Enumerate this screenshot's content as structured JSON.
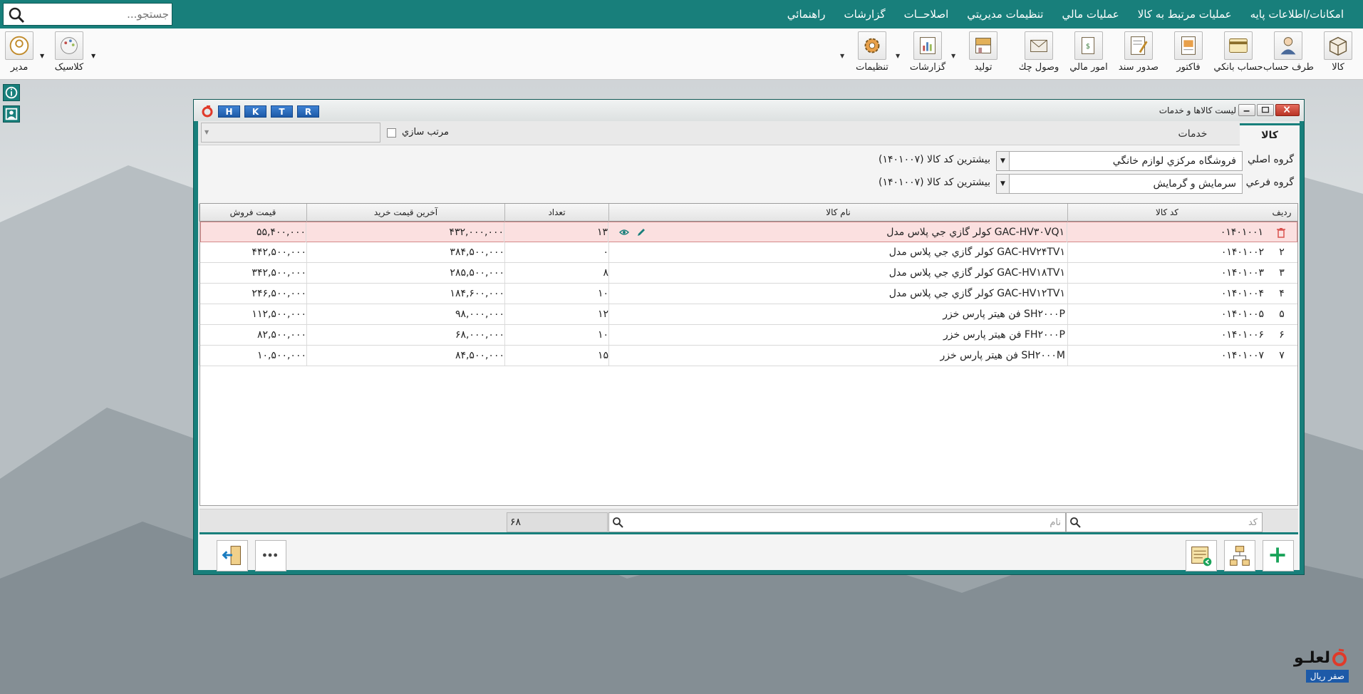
{
  "menu": {
    "items": [
      "امکانات/اطلاعات پايه",
      "عمليات مرتبط به کالا",
      "عمليات مالي",
      "تنظيمات مديريتي",
      "اصلاحــات",
      "گزارشات",
      "راهنمائي"
    ],
    "search_placeholder": "جستجو..."
  },
  "toolbar": {
    "items": [
      "کالا",
      "طرف حساب",
      "حساب بانکي",
      "فاکتور",
      "صدور سند",
      "امور مالي",
      "وصول چك",
      "توليد",
      "گزارشات",
      "تنظيمات"
    ],
    "left_items": [
      "کلاسیک",
      "مدير"
    ]
  },
  "window": {
    "title": "ليست کالاها و خدمات",
    "hotkeys": [
      "H",
      "K",
      "T",
      "R"
    ]
  },
  "tabs": {
    "active": "كالا",
    "inactive": "خدمات"
  },
  "sort": {
    "label": "مرتب سازي"
  },
  "filters": {
    "main_group_label": "گروه اصلي",
    "main_group_value": "فروشگاه مرکزي لوازم خانگي",
    "main_group_note": "بيشترين کد کالا (۱۴۰۱۰۰۷)",
    "sub_group_label": "گروه فرعي",
    "sub_group_value": "سرمايش و گرمايش",
    "sub_group_note": "بيشترين کد کالا (۱۴۰۱۰۰۷)"
  },
  "grid": {
    "columns": [
      "رديف",
      "کد کالا",
      "نام کالا",
      "تعداد",
      "آخرين قيمت خريد",
      "قيمت فروش"
    ],
    "rows": [
      {
        "idx": "",
        "code": "۰۱۴۰۱۰۰۱",
        "name": "كولر گازي جي پلاس مدل GAC-HV۳۰VQ۱",
        "qty": "۱۳",
        "buy": "۴۳۲,۰۰۰,۰۰۰",
        "sell": "۵۵,۴۰۰,۰۰۰"
      },
      {
        "idx": "۲",
        "code": "۰۱۴۰۱۰۰۲",
        "name": "كولر گازي جي پلاس مدل GAC-HV۲۴TV۱",
        "qty": "۰",
        "buy": "۳۸۴,۵۰۰,۰۰۰",
        "sell": "۴۴۲,۵۰۰,۰۰۰"
      },
      {
        "idx": "۳",
        "code": "۰۱۴۰۱۰۰۳",
        "name": "كولر گازي جي پلاس مدل GAC-HV۱۸TV۱",
        "qty": "۸",
        "buy": "۲۸۵,۵۰۰,۰۰۰",
        "sell": "۳۴۲,۵۰۰,۰۰۰"
      },
      {
        "idx": "۴",
        "code": "۰۱۴۰۱۰۰۴",
        "name": "كولر گازي جي پلاس مدل GAC-HV۱۲TV۱",
        "qty": "۱۰",
        "buy": "۱۸۴,۶۰۰,۰۰۰",
        "sell": "۲۴۶,۵۰۰,۰۰۰"
      },
      {
        "idx": "۵",
        "code": "۰۱۴۰۱۰۰۵",
        "name": "فن هيتر پارس خزر SH۲۰۰۰P",
        "qty": "۱۲",
        "buy": "۹۸,۰۰۰,۰۰۰",
        "sell": "۱۱۲,۵۰۰,۰۰۰"
      },
      {
        "idx": "۶",
        "code": "۰۱۴۰۱۰۰۶",
        "name": "فن هيتر پارس خزر FH۲۰۰۰P",
        "qty": "۱۰",
        "buy": "۶۸,۰۰۰,۰۰۰",
        "sell": "۸۲,۵۰۰,۰۰۰"
      },
      {
        "idx": "۷",
        "code": "۰۱۴۰۱۰۰۷",
        "name": "فن هيتر پارس خزر SH۲۰۰۰M",
        "qty": "۱۵",
        "buy": "۸۴,۵۰۰,۰۰۰",
        "sell": "۱۰,۵۰۰,۰۰۰"
      }
    ]
  },
  "search": {
    "code_placeholder": "کد",
    "name_placeholder": "نام",
    "count": "۶۸"
  },
  "brand": {
    "logo_text": "لعلـو",
    "badge": "صفر ريال"
  }
}
